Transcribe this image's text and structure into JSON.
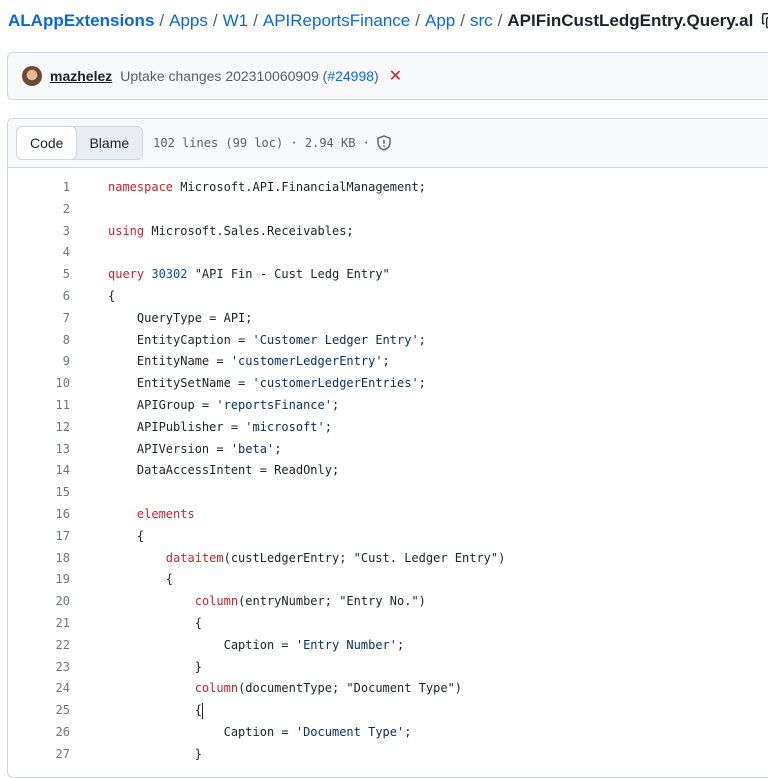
{
  "breadcrumb": {
    "repo": "ALAppExtensions",
    "parts": [
      "Apps",
      "W1",
      "APIReportsFinance",
      "App",
      "src"
    ],
    "file": "APIFinCustLedgEntry.Query.al",
    "separator": "/"
  },
  "commit": {
    "author": "mazhelez",
    "message": "Uptake changes 202310060909 (",
    "pr": "#24998",
    "message_end": ")",
    "status": "✕"
  },
  "file_header": {
    "tabs": [
      "Code",
      "Blame"
    ],
    "active_tab": "Code",
    "info": "102 lines (99 loc) · 2.94 KB ·"
  },
  "icons": {
    "copy": "copy-icon",
    "security": "shield-icon",
    "avatar": "avatar"
  },
  "colors": {
    "link": "#0969da",
    "keyword": "#cf222e",
    "string": "#0a3069",
    "number": "#0550ae",
    "line_number": "#6e7781"
  },
  "code_lines": [
    [
      {
        "t": "namespace",
        "c": "kw"
      },
      {
        "t": " Microsoft.API.FinancialManagement;"
      }
    ],
    [],
    [
      {
        "t": "using",
        "c": "kw"
      },
      {
        "t": " Microsoft.Sales.Receivables;"
      }
    ],
    [],
    [
      {
        "t": "query",
        "c": "kw"
      },
      {
        "t": " "
      },
      {
        "t": "30302",
        "c": "num"
      },
      {
        "t": " \"API Fin - Cust Ledg Entry\""
      }
    ],
    [
      {
        "t": "{"
      }
    ],
    [
      {
        "t": "    QueryType = API;"
      }
    ],
    [
      {
        "t": "    EntityCaption = "
      },
      {
        "t": "'Customer Ledger Entry'",
        "c": "str"
      },
      {
        "t": ";"
      }
    ],
    [
      {
        "t": "    EntityName = "
      },
      {
        "t": "'customerLedgerEntry'",
        "c": "str"
      },
      {
        "t": ";"
      }
    ],
    [
      {
        "t": "    EntitySetName = "
      },
      {
        "t": "'customerLedgerEntries'",
        "c": "str"
      },
      {
        "t": ";"
      }
    ],
    [
      {
        "t": "    APIGroup = "
      },
      {
        "t": "'reportsFinance'",
        "c": "str"
      },
      {
        "t": ";"
      }
    ],
    [
      {
        "t": "    APIPublisher = "
      },
      {
        "t": "'microsoft'",
        "c": "str"
      },
      {
        "t": ";"
      }
    ],
    [
      {
        "t": "    APIVersion = "
      },
      {
        "t": "'beta'",
        "c": "str"
      },
      {
        "t": ";"
      }
    ],
    [
      {
        "t": "    DataAccessIntent = ReadOnly;"
      }
    ],
    [],
    [
      {
        "t": "    "
      },
      {
        "t": "elements",
        "c": "kw"
      }
    ],
    [
      {
        "t": "    {"
      }
    ],
    [
      {
        "t": "        "
      },
      {
        "t": "dataitem",
        "c": "kw"
      },
      {
        "t": "(custLedgerEntry; \"Cust. Ledger Entry\")"
      }
    ],
    [
      {
        "t": "        {"
      }
    ],
    [
      {
        "t": "            "
      },
      {
        "t": "column",
        "c": "kw"
      },
      {
        "t": "(entryNumber; \"Entry No.\")"
      }
    ],
    [
      {
        "t": "            {"
      }
    ],
    [
      {
        "t": "                Caption = "
      },
      {
        "t": "'Entry Number'",
        "c": "str"
      },
      {
        "t": ";"
      }
    ],
    [
      {
        "t": "            }"
      }
    ],
    [
      {
        "t": "            "
      },
      {
        "t": "column",
        "c": "kw"
      },
      {
        "t": "(documentType; \"Document Type\")"
      }
    ],
    [
      {
        "t": "            {"
      },
      {
        "t": "",
        "caret": true
      }
    ],
    [
      {
        "t": "                Caption = "
      },
      {
        "t": "'Document Type'",
        "c": "str"
      },
      {
        "t": ";"
      }
    ],
    [
      {
        "t": "            }"
      }
    ]
  ]
}
